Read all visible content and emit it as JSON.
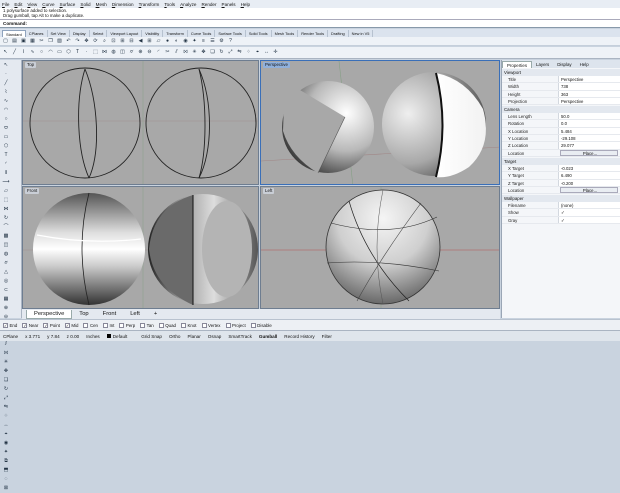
{
  "menu": [
    "File",
    "Edit",
    "View",
    "Curve",
    "Surface",
    "Solid",
    "Mesh",
    "Dimension",
    "Transform",
    "Tools",
    "Analyze",
    "Render",
    "Panels",
    "Help"
  ],
  "command_history": [
    "1 polysurface added to selection.",
    "Drag gumball, tap Alt to make a duplicate."
  ],
  "command_prompt": "Command:",
  "toolbar_tabs": [
    "Standard",
    "CPlanes",
    "Set View",
    "Display",
    "Select",
    "Viewport Layout",
    "Visibility",
    "Transform",
    "Curve Tools",
    "Surface Tools",
    "Solid Tools",
    "Mesh Tools",
    "Render Tools",
    "Drafting",
    "New in V5"
  ],
  "viewports": {
    "top": "Top",
    "perspective": "Perspective",
    "front": "Front",
    "left": "Left"
  },
  "viewport_tabs": [
    "Perspective",
    "Top",
    "Front",
    "Left"
  ],
  "viewport_tab_add": "+",
  "panel": {
    "tabs": [
      "Properties",
      "Layers",
      "Display",
      "Help"
    ],
    "viewport_section": "Viewport",
    "viewport_rows": [
      {
        "k": "Title",
        "v": "Perspective"
      },
      {
        "k": "Width",
        "v": "738"
      },
      {
        "k": "Height",
        "v": "363"
      },
      {
        "k": "Projection",
        "v": "Perspective"
      }
    ],
    "camera_section": "Camera",
    "camera_rows": [
      {
        "k": "Lens Length",
        "v": "50.0"
      },
      {
        "k": "Rotation",
        "v": "0.0"
      },
      {
        "k": "X Location",
        "v": "5.484"
      },
      {
        "k": "Y Location",
        "v": "-29.108"
      },
      {
        "k": "Z Location",
        "v": "29.077"
      }
    ],
    "location_label": "Location",
    "place_button": "Place...",
    "target_section": "Target",
    "target_rows": [
      {
        "k": "X Target",
        "v": "-0.023"
      },
      {
        "k": "Y Target",
        "v": "6.490"
      },
      {
        "k": "Z Target",
        "v": "-0.200"
      }
    ],
    "wallpaper_section": "Wallpaper",
    "wallpaper_rows": [
      {
        "k": "Filename",
        "v": "(none)"
      },
      {
        "k": "Show",
        "v": "✓"
      },
      {
        "k": "Gray",
        "v": "✓"
      }
    ]
  },
  "osnaps": [
    {
      "label": "End",
      "checked": true
    },
    {
      "label": "Near",
      "checked": true
    },
    {
      "label": "Point",
      "checked": true
    },
    {
      "label": "Mid",
      "checked": true
    },
    {
      "label": "Cen",
      "checked": false
    },
    {
      "label": "Int",
      "checked": false
    },
    {
      "label": "Perp",
      "checked": false
    },
    {
      "label": "Tan",
      "checked": false
    },
    {
      "label": "Quad",
      "checked": false
    },
    {
      "label": "Knot",
      "checked": false
    },
    {
      "label": "Vertex",
      "checked": false
    },
    {
      "label": "Project",
      "checked": false
    },
    {
      "label": "Disable",
      "checked": false
    }
  ],
  "status": {
    "cplane": "CPlane",
    "x": "x 3.771",
    "y": "y 7.84",
    "z": "z 0.00",
    "units": "Inches",
    "layer": "Default",
    "toggles": [
      "Grid Snap",
      "Ortho",
      "Planar",
      "Osnap",
      "SmartTrack",
      "Gumball",
      "Record History",
      "Filter"
    ]
  }
}
